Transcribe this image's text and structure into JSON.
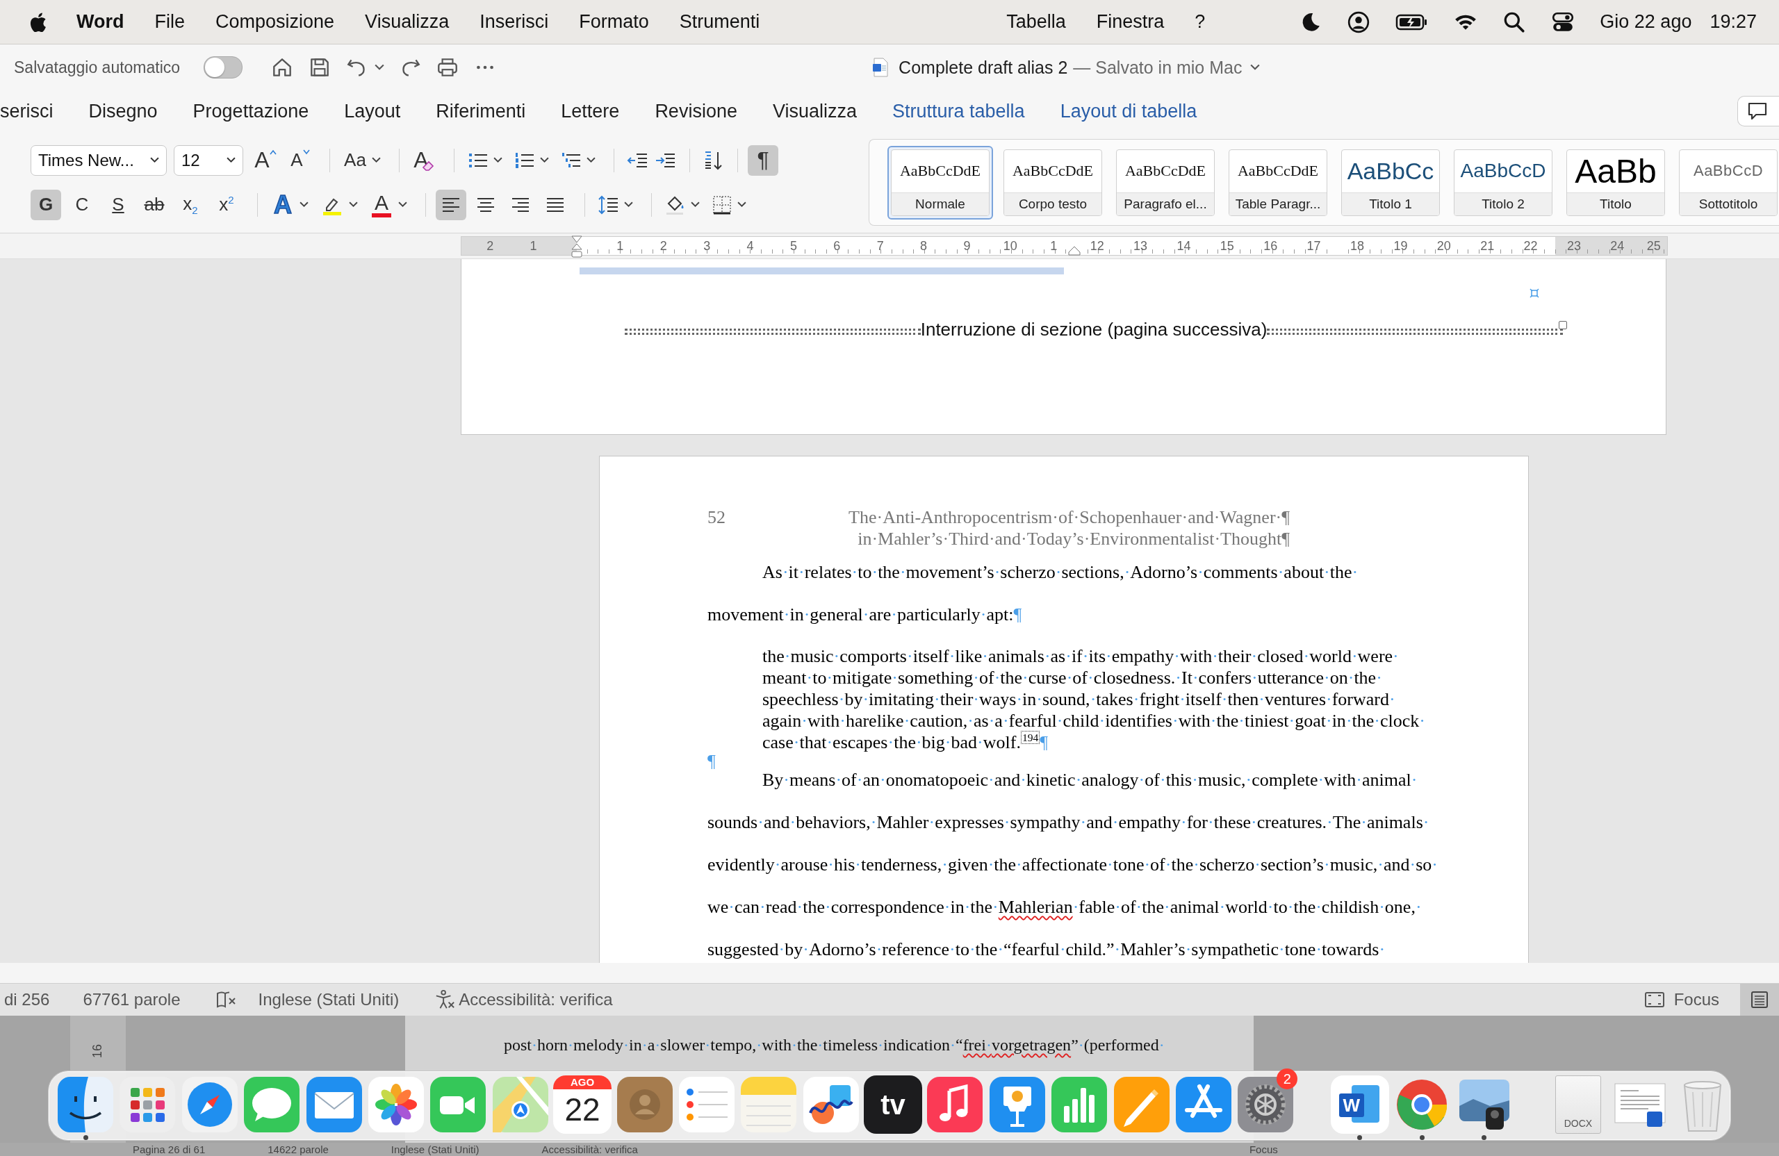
{
  "menu_bar": {
    "app": "Word",
    "items": [
      "File",
      "Composizione",
      "Visualizza",
      "Inserisci",
      "Formato",
      "Strumenti"
    ],
    "right_items": [
      "Tabella",
      "Finestra",
      "?"
    ],
    "date": "Gio 22 ago",
    "time": "19:27"
  },
  "title_bar": {
    "autosave_label": "Salvataggio automatico",
    "autosave_on": false,
    "document": "Complete draft alias 2",
    "location": "— Salvato in mio Mac"
  },
  "ribbon_tabs": [
    {
      "label": "serisci",
      "contextual": false
    },
    {
      "label": "Disegno",
      "contextual": false
    },
    {
      "label": "Progettazione",
      "contextual": false
    },
    {
      "label": "Layout",
      "contextual": false
    },
    {
      "label": "Riferimenti",
      "contextual": false
    },
    {
      "label": "Lettere",
      "contextual": false
    },
    {
      "label": "Revisione",
      "contextual": false
    },
    {
      "label": "Visualizza",
      "contextual": false
    },
    {
      "label": "Struttura tabella",
      "contextual": true
    },
    {
      "label": "Layout di tabella",
      "contextual": true
    }
  ],
  "ribbon": {
    "font_name": "Times New...",
    "font_size": "12",
    "grow_label": "A",
    "shrink_label": "A",
    "case_label": "Aa",
    "clear_label": "A",
    "char_buttons": [
      {
        "kind": "bold",
        "label": "G",
        "selected": true
      },
      {
        "kind": "italic",
        "label": "C",
        "selected": false
      },
      {
        "kind": "underline",
        "label": "S",
        "selected": false
      },
      {
        "kind": "strike",
        "label": "ab",
        "selected": false
      },
      {
        "kind": "subscript",
        "label": "x$_{2}$",
        "selected": false
      },
      {
        "kind": "superscript",
        "label": "x$^{2}$",
        "selected": false
      }
    ],
    "color_buttons": [
      {
        "kind": "effects",
        "label": "A",
        "color": "#2f7fd6"
      },
      {
        "kind": "highlight",
        "color": "#f5f200"
      },
      {
        "kind": "font_color",
        "label": "A",
        "color": "#e81123"
      }
    ],
    "align_buttons": [
      {
        "kind": "left",
        "selected": true
      },
      {
        "kind": "center",
        "selected": false
      },
      {
        "kind": "right",
        "selected": false
      },
      {
        "kind": "justify",
        "selected": false
      }
    ],
    "show_marks": {
      "label": "¶",
      "selected": true
    },
    "styles": [
      {
        "preview": "AaBbCcDdE",
        "name": "Normale",
        "kind": "serif",
        "selected": true
      },
      {
        "preview": "AaBbCcDdE",
        "name": "Corpo testo",
        "kind": "serif",
        "selected": false
      },
      {
        "preview": "AaBbCcDdE",
        "name": "Paragrafo el...",
        "kind": "serif",
        "selected": false
      },
      {
        "preview": "AaBbCcDdE",
        "name": "Table Paragr...",
        "kind": "serif",
        "selected": false
      },
      {
        "preview": "AaBbCc",
        "name": "Titolo 1",
        "kind": "heading1",
        "selected": false
      },
      {
        "preview": "AaBbCcD",
        "name": "Titolo 2",
        "kind": "heading2",
        "selected": false
      },
      {
        "preview": "AaBb",
        "name": "Titolo",
        "kind": "title",
        "selected": false
      },
      {
        "preview": "AaBbCcD",
        "name": "Sottotitolo",
        "kind": "subtitle",
        "selected": false
      }
    ]
  },
  "ruler": {
    "left_labels": [
      "2",
      "1"
    ],
    "labels": [
      "1",
      "2",
      "3",
      "4",
      "5",
      "6",
      "7",
      "8",
      "9",
      "10",
      "1",
      "12",
      "13",
      "14",
      "15",
      "16",
      "17",
      "18",
      "19",
      "20",
      "21",
      "22",
      "23",
      "24",
      "25"
    ]
  },
  "page_1": {
    "section_break": "Interruzione di sezione (pagina successiva)"
  },
  "page_2": {
    "page_number": "52",
    "running_head": [
      "The·Anti-Anthropocentrism·of·Schopenhauer·and·Wagner·¶",
      "in·Mahler’s·Third·and·Today’s·Environmentalist·Thought¶"
    ],
    "paragraphs": [
      {
        "kind": "body",
        "lines": [
          {
            "text": "As·it·relates·to·the·movement’s·scherzo·sections,·Adorno’s·comments·about·the·"
          },
          {
            "text": "movement·in·general·are·particularly·apt:¶"
          }
        ]
      },
      {
        "kind": "block_quote",
        "lines": [
          {
            "text": "the·music·comports·itself·like·animals·as·if·its·empathy·with·their·closed·world·were·"
          },
          {
            "text": "meant·to·mitigate·something·of·the·curse·of·closedness.·It·confers·utterance·on·the·"
          },
          {
            "text": "speechless·by·imitating·their·ways·in·sound,·takes·fright·itself·then·ventures·forward·"
          },
          {
            "text": "again·with·harelike·caution,·as·a·fearful·child·identifies·with·the·tiniest·goat·in·the·clock·"
          },
          {
            "text": "case·that·escapes·the·big·bad·wolf.$^{194}$¶"
          }
        ]
      },
      {
        "kind": "empty",
        "lines": [
          {
            "text": "¶"
          }
        ]
      },
      {
        "kind": "body",
        "lines": [
          {
            "text": "By·means·of·an·onomatopoeic·and·kinetic·analogy·of·this·music,·complete·with·animal·"
          },
          {
            "text": "sounds·and·behaviors,·Mahler·expresses·sympathy·and·empathy·for·these·creatures.·The·animals·"
          },
          {
            "text": "evidently·arouse·his·tenderness,·given·the·affectionate·tone·of·the·scherzo·section’s·music,·and·so·"
          },
          {
            "parts": [
              {
                "text": "we·can·read·the·correspondence·in·the·",
                "misspelled": false
              },
              {
                "text": "Mahlerian",
                "misspelled": true
              },
              {
                "text": "·fable·of·the·animal·world·to·the·childish·one,·",
                "misspelled": false
              }
            ]
          },
          {
            "text": "suggested·by·Adorno’s·reference·to·the·“fearful·child.”·Mahler’s·sympathetic·tone·towards·"
          }
        ]
      }
    ]
  },
  "status_bar": {
    "pages": "di 256",
    "words": "67761 parole",
    "language": "Inglese (Stati Uniti)",
    "accessibility": "Accessibilità: verifica",
    "focus": "Focus"
  },
  "background_window": {
    "ruler_label": "16",
    "line": [
      {
        "text": "post·horn·melody·in·a·slower·tempo,·with·the·timeless·indication·“",
        "misspelled": false
      },
      {
        "text": "frei·vorgetragen",
        "misspelled": true
      },
      {
        "text": "”·(performed·",
        "misspelled": false
      }
    ],
    "status": [
      "Pagina 26 di 61",
      "14622 parole",
      "Inglese (Stati Uniti)",
      "Accessibilità: verifica",
      "Focus"
    ]
  },
  "dock": [
    {
      "kind": "finder",
      "running": true
    },
    {
      "kind": "launchpad",
      "running": false
    },
    {
      "kind": "safari",
      "running": false
    },
    {
      "kind": "messages",
      "running": false
    },
    {
      "kind": "mail",
      "running": false
    },
    {
      "kind": "photos",
      "running": false
    },
    {
      "kind": "facetime",
      "running": false
    },
    {
      "kind": "maps",
      "running": false
    },
    {
      "kind": "calendar",
      "month": "AGO",
      "day": "22",
      "running": false
    },
    {
      "kind": "contacts",
      "running": false
    },
    {
      "kind": "reminders",
      "running": false
    },
    {
      "kind": "notes",
      "running": false
    },
    {
      "kind": "freeform",
      "running": false
    },
    {
      "kind": "tv",
      "label": "tv",
      "running": false
    },
    {
      "kind": "music",
      "running": false
    },
    {
      "kind": "keynote",
      "running": false
    },
    {
      "kind": "numbers",
      "running": false
    },
    {
      "kind": "pages",
      "running": false
    },
    {
      "kind": "appstore",
      "running": false
    },
    {
      "kind": "settings",
      "badge": "2",
      "running": false
    },
    {
      "kind": "separator"
    },
    {
      "kind": "word",
      "letter": "W",
      "running": true
    },
    {
      "kind": "chrome",
      "running": true
    },
    {
      "kind": "preview",
      "running": true
    },
    {
      "kind": "separator"
    },
    {
      "kind": "document",
      "label": "DOCX",
      "running": false
    },
    {
      "kind": "thumbnail",
      "running": false
    },
    {
      "kind": "trash",
      "running": false
    }
  ]
}
